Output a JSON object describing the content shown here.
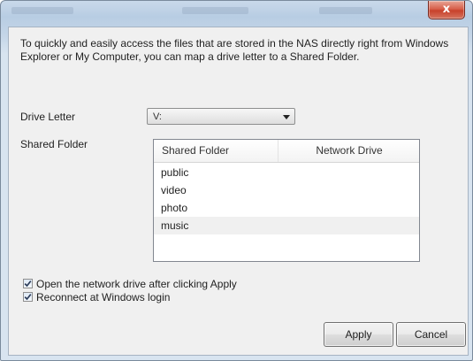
{
  "window": {
    "close_glyph": "x"
  },
  "intro_text": "To quickly and easily access the files that are stored in the NAS directly right from Windows Explorer or My Computer, you can map a drive letter to a Shared Folder.",
  "drive_letter": {
    "label": "Drive Letter",
    "value": "V:"
  },
  "shared_folder": {
    "label": "Shared Folder",
    "columns": [
      "Shared Folder",
      "Network Drive"
    ],
    "rows": [
      {
        "name": "public",
        "drive": ""
      },
      {
        "name": "video",
        "drive": ""
      },
      {
        "name": "photo",
        "drive": ""
      },
      {
        "name": "music",
        "drive": ""
      }
    ],
    "selected_index": 3
  },
  "options": {
    "open_after_apply": {
      "label": "Open the network drive after clicking Apply",
      "checked": true
    },
    "reconnect_login": {
      "label": "Reconnect at Windows login",
      "checked": true
    }
  },
  "buttons": {
    "apply": "Apply",
    "cancel": "Cancel"
  }
}
